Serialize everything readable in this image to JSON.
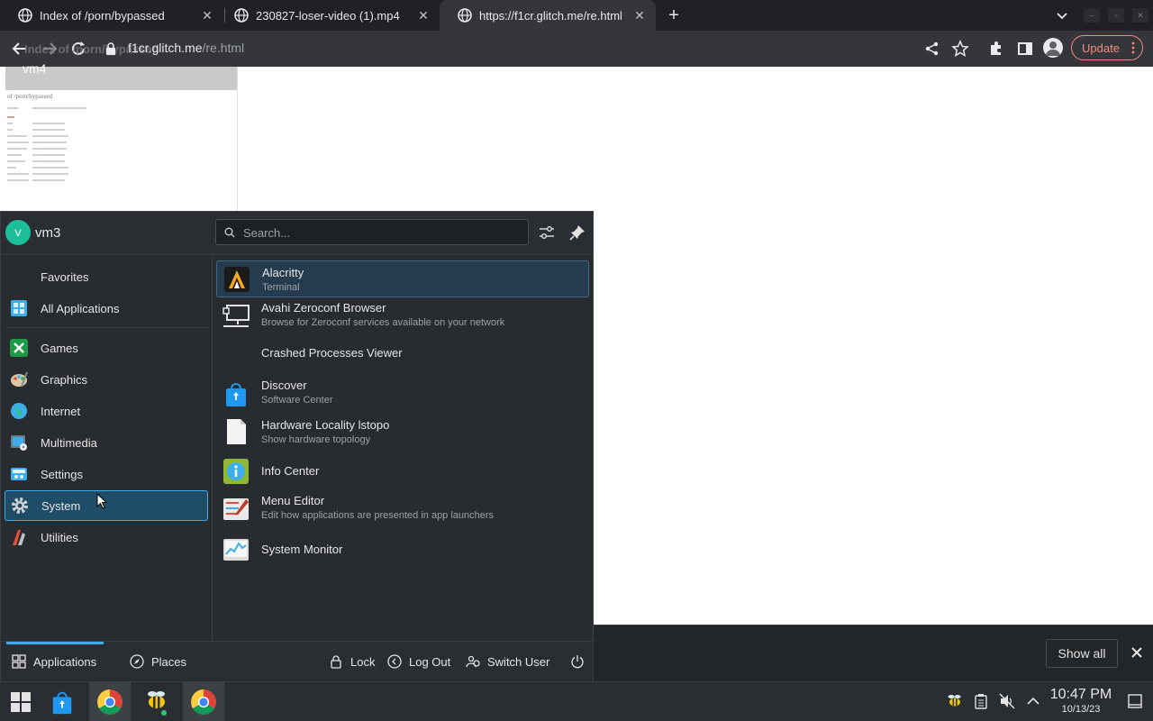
{
  "browser": {
    "tabs": [
      {
        "title": "Index of /porn/bypassed",
        "active": false
      },
      {
        "title": "230827-loser-video (1).mp4",
        "active": false
      },
      {
        "title": "https://f1cr.glitch.me/re.html",
        "active": true
      }
    ],
    "url_host": "f1cr.glitch.me",
    "url_path": "/re.html",
    "ghost_title": "Index of /porn/bypassed",
    "update_label": "Update"
  },
  "page": {
    "thumb_heading": "vm4",
    "thumb_subtitle": "of /porn/bypassed"
  },
  "kmenu": {
    "user": "vm3",
    "avatar_letter": "V",
    "search_placeholder": "Search...",
    "categories": [
      {
        "label": "Favorites",
        "icon": "star-icon"
      },
      {
        "label": "All Applications",
        "icon": "grid-icon"
      },
      {
        "label": "Games",
        "icon": "gamepad-icon"
      },
      {
        "label": "Graphics",
        "icon": "palette-icon"
      },
      {
        "label": "Internet",
        "icon": "globe-icon"
      },
      {
        "label": "Multimedia",
        "icon": "multimedia-icon"
      },
      {
        "label": "Settings",
        "icon": "settings-icon"
      },
      {
        "label": "System",
        "icon": "gear-icon"
      },
      {
        "label": "Utilities",
        "icon": "utilities-icon"
      }
    ],
    "selected_category": "System",
    "apps": [
      {
        "name": "Alacritty",
        "desc": "Terminal",
        "icon": "terminal-icon"
      },
      {
        "name": "Avahi Zeroconf Browser",
        "desc": "Browse for Zeroconf services available on your network",
        "icon": "network-icon"
      },
      {
        "name": "Crashed Processes Viewer",
        "desc": "",
        "icon": "bug-icon"
      },
      {
        "name": "Discover",
        "desc": "Software Center",
        "icon": "shopping-bag-icon"
      },
      {
        "name": "Hardware Locality lstopo",
        "desc": "Show hardware topology",
        "icon": "document-icon"
      },
      {
        "name": "Info Center",
        "desc": "",
        "icon": "info-icon"
      },
      {
        "name": "Menu Editor",
        "desc": "Edit how applications are presented in app launchers",
        "icon": "menu-editor-icon"
      },
      {
        "name": "System Monitor",
        "desc": "",
        "icon": "monitor-chart-icon"
      }
    ],
    "footer": {
      "applications": "Applications",
      "places": "Places",
      "lock": "Lock",
      "logout": "Log Out",
      "switch_user": "Switch User"
    }
  },
  "notification": {
    "show_all": "Show all"
  },
  "taskbar": {
    "time": "10:47 PM",
    "date": "10/13/23"
  },
  "colors": {
    "accent": "#3daee9",
    "selection": "#1f4d68",
    "update": "#f28b82"
  }
}
